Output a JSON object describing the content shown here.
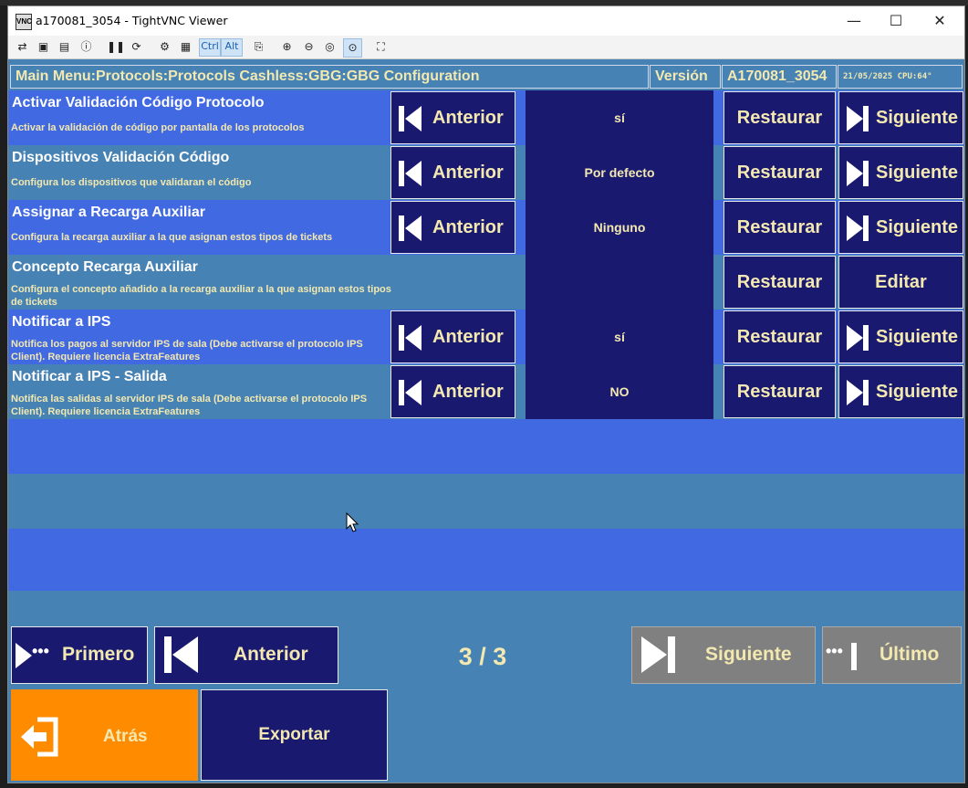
{
  "window": {
    "title": "a170081_3054 - TightVNC Viewer",
    "app_icon": "VNC",
    "minimize": "—",
    "maximize": "☐",
    "close": "✕"
  },
  "toolbar": {
    "ctrl": "Ctrl",
    "alt": "Alt"
  },
  "header": {
    "breadcrumb": "Main Menu:Protocols:Protocols Cashless:GBG:GBG Configuration",
    "version_label": "Versión",
    "version_value": "A170081_3054",
    "status": "21/05/2025 CPU:64°"
  },
  "rows": [
    {
      "title": "Activar Validación Código Protocolo",
      "desc": "Activar la validación de código por pantalla de los protocolos",
      "value": "sí",
      "prev": "Anterior",
      "restore": "Restaurar",
      "next": "Siguiente"
    },
    {
      "title": "Dispositivos Validación Código",
      "desc": "Configura los dispositivos que validaran el código",
      "value": "Por defecto",
      "prev": "Anterior",
      "restore": "Restaurar",
      "next": "Siguiente"
    },
    {
      "title": "Assignar a Recarga Auxiliar",
      "desc": "Configura la recarga auxiliar a la que asignan estos tipos de tickets",
      "value": "Ninguno",
      "prev": "Anterior",
      "restore": "Restaurar",
      "next": "Siguiente"
    },
    {
      "title": "Concepto Recarga Auxiliar",
      "desc": "Configura el concepto añadido a la recarga auxiliar a la que asignan estos tipos de tickets",
      "value": "",
      "restore": "Restaurar",
      "edit": "Editar"
    },
    {
      "title": "Notificar a IPS",
      "desc": "Notifica los pagos al servidor IPS de sala (Debe activarse el protocolo IPS Client). Requiere licencia ExtraFeatures",
      "value": "sí",
      "prev": "Anterior",
      "restore": "Restaurar",
      "next": "Siguiente"
    },
    {
      "title": "Notificar a IPS - Salida",
      "desc": "Notifica las salidas al servidor IPS de sala (Debe activarse el protocolo IPS Client). Requiere licencia ExtraFeatures",
      "value": "NO",
      "prev": "Anterior",
      "restore": "Restaurar",
      "next": "Siguiente"
    }
  ],
  "pager": {
    "first": "Primero",
    "prev": "Anterior",
    "page": "3 / 3",
    "next": "Siguiente",
    "last": "Último"
  },
  "footer": {
    "back": "Atrás",
    "export": "Exportar"
  },
  "colors": {
    "row_light": "#4169e1",
    "row_dark": "#4682b4",
    "button_bg": "#191970",
    "text_yellow": "#f2e8b0",
    "back_orange": "#ff8c00",
    "disabled_gray": "#808080"
  }
}
